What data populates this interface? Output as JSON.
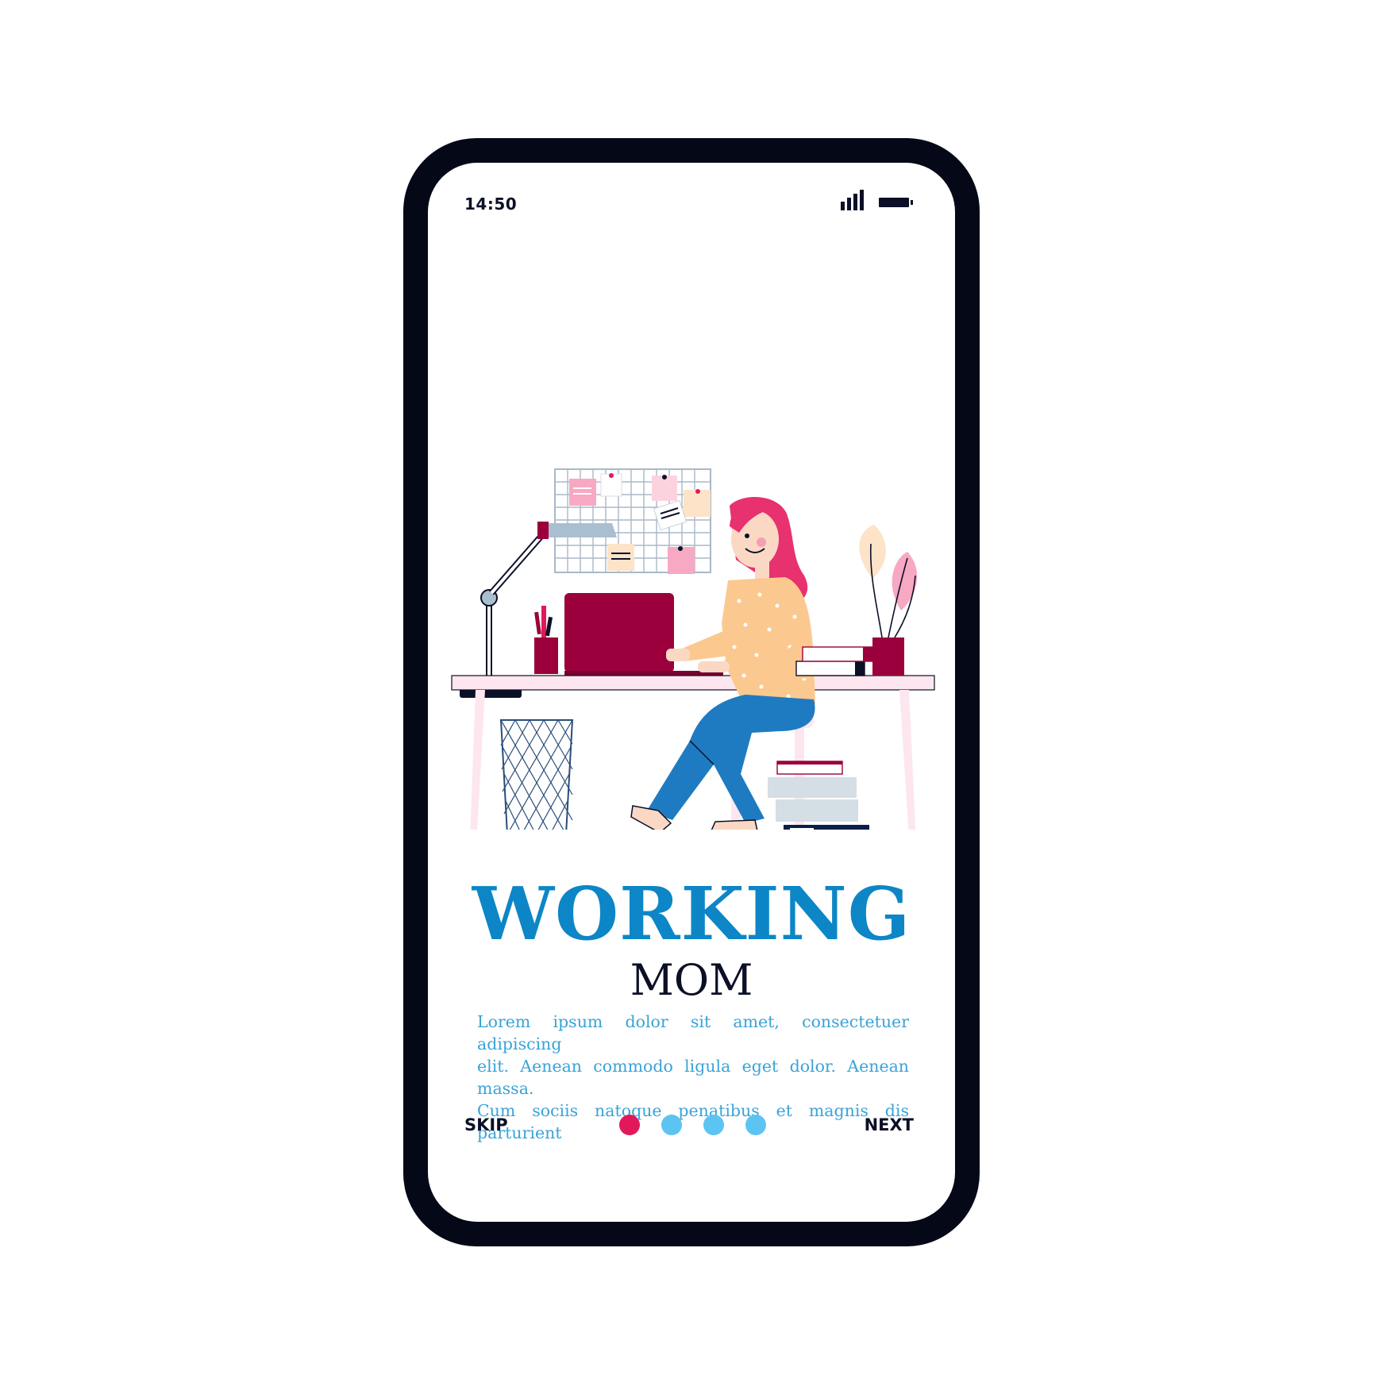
{
  "status_bar": {
    "time": "14:50",
    "signal_icon": "signal-bars-icon",
    "battery_icon": "battery-icon"
  },
  "onboarding": {
    "title": "WORKING",
    "subtitle": "MOM",
    "body_lines": [
      "Lorem ipsum dolor sit amet, consectetuer adipiscing",
      "elit. Aenean commodo ligula eget dolor. Aenean massa.",
      "Cum sociis natoque penatibus et magnis dis parturient"
    ],
    "skip_label": "SKIP",
    "next_label": "NEXT",
    "page_count": 4,
    "active_page": 1
  },
  "colors": {
    "frame": "#050816",
    "title": "#0c86c6",
    "body_text": "#3aa3d8",
    "dot_active": "#e1195b",
    "dot_inactive": "#5cc4f2",
    "accent_burgundy": "#9b003c",
    "hair_pink": "#e8316f",
    "jeans_blue": "#1f7bc1"
  }
}
